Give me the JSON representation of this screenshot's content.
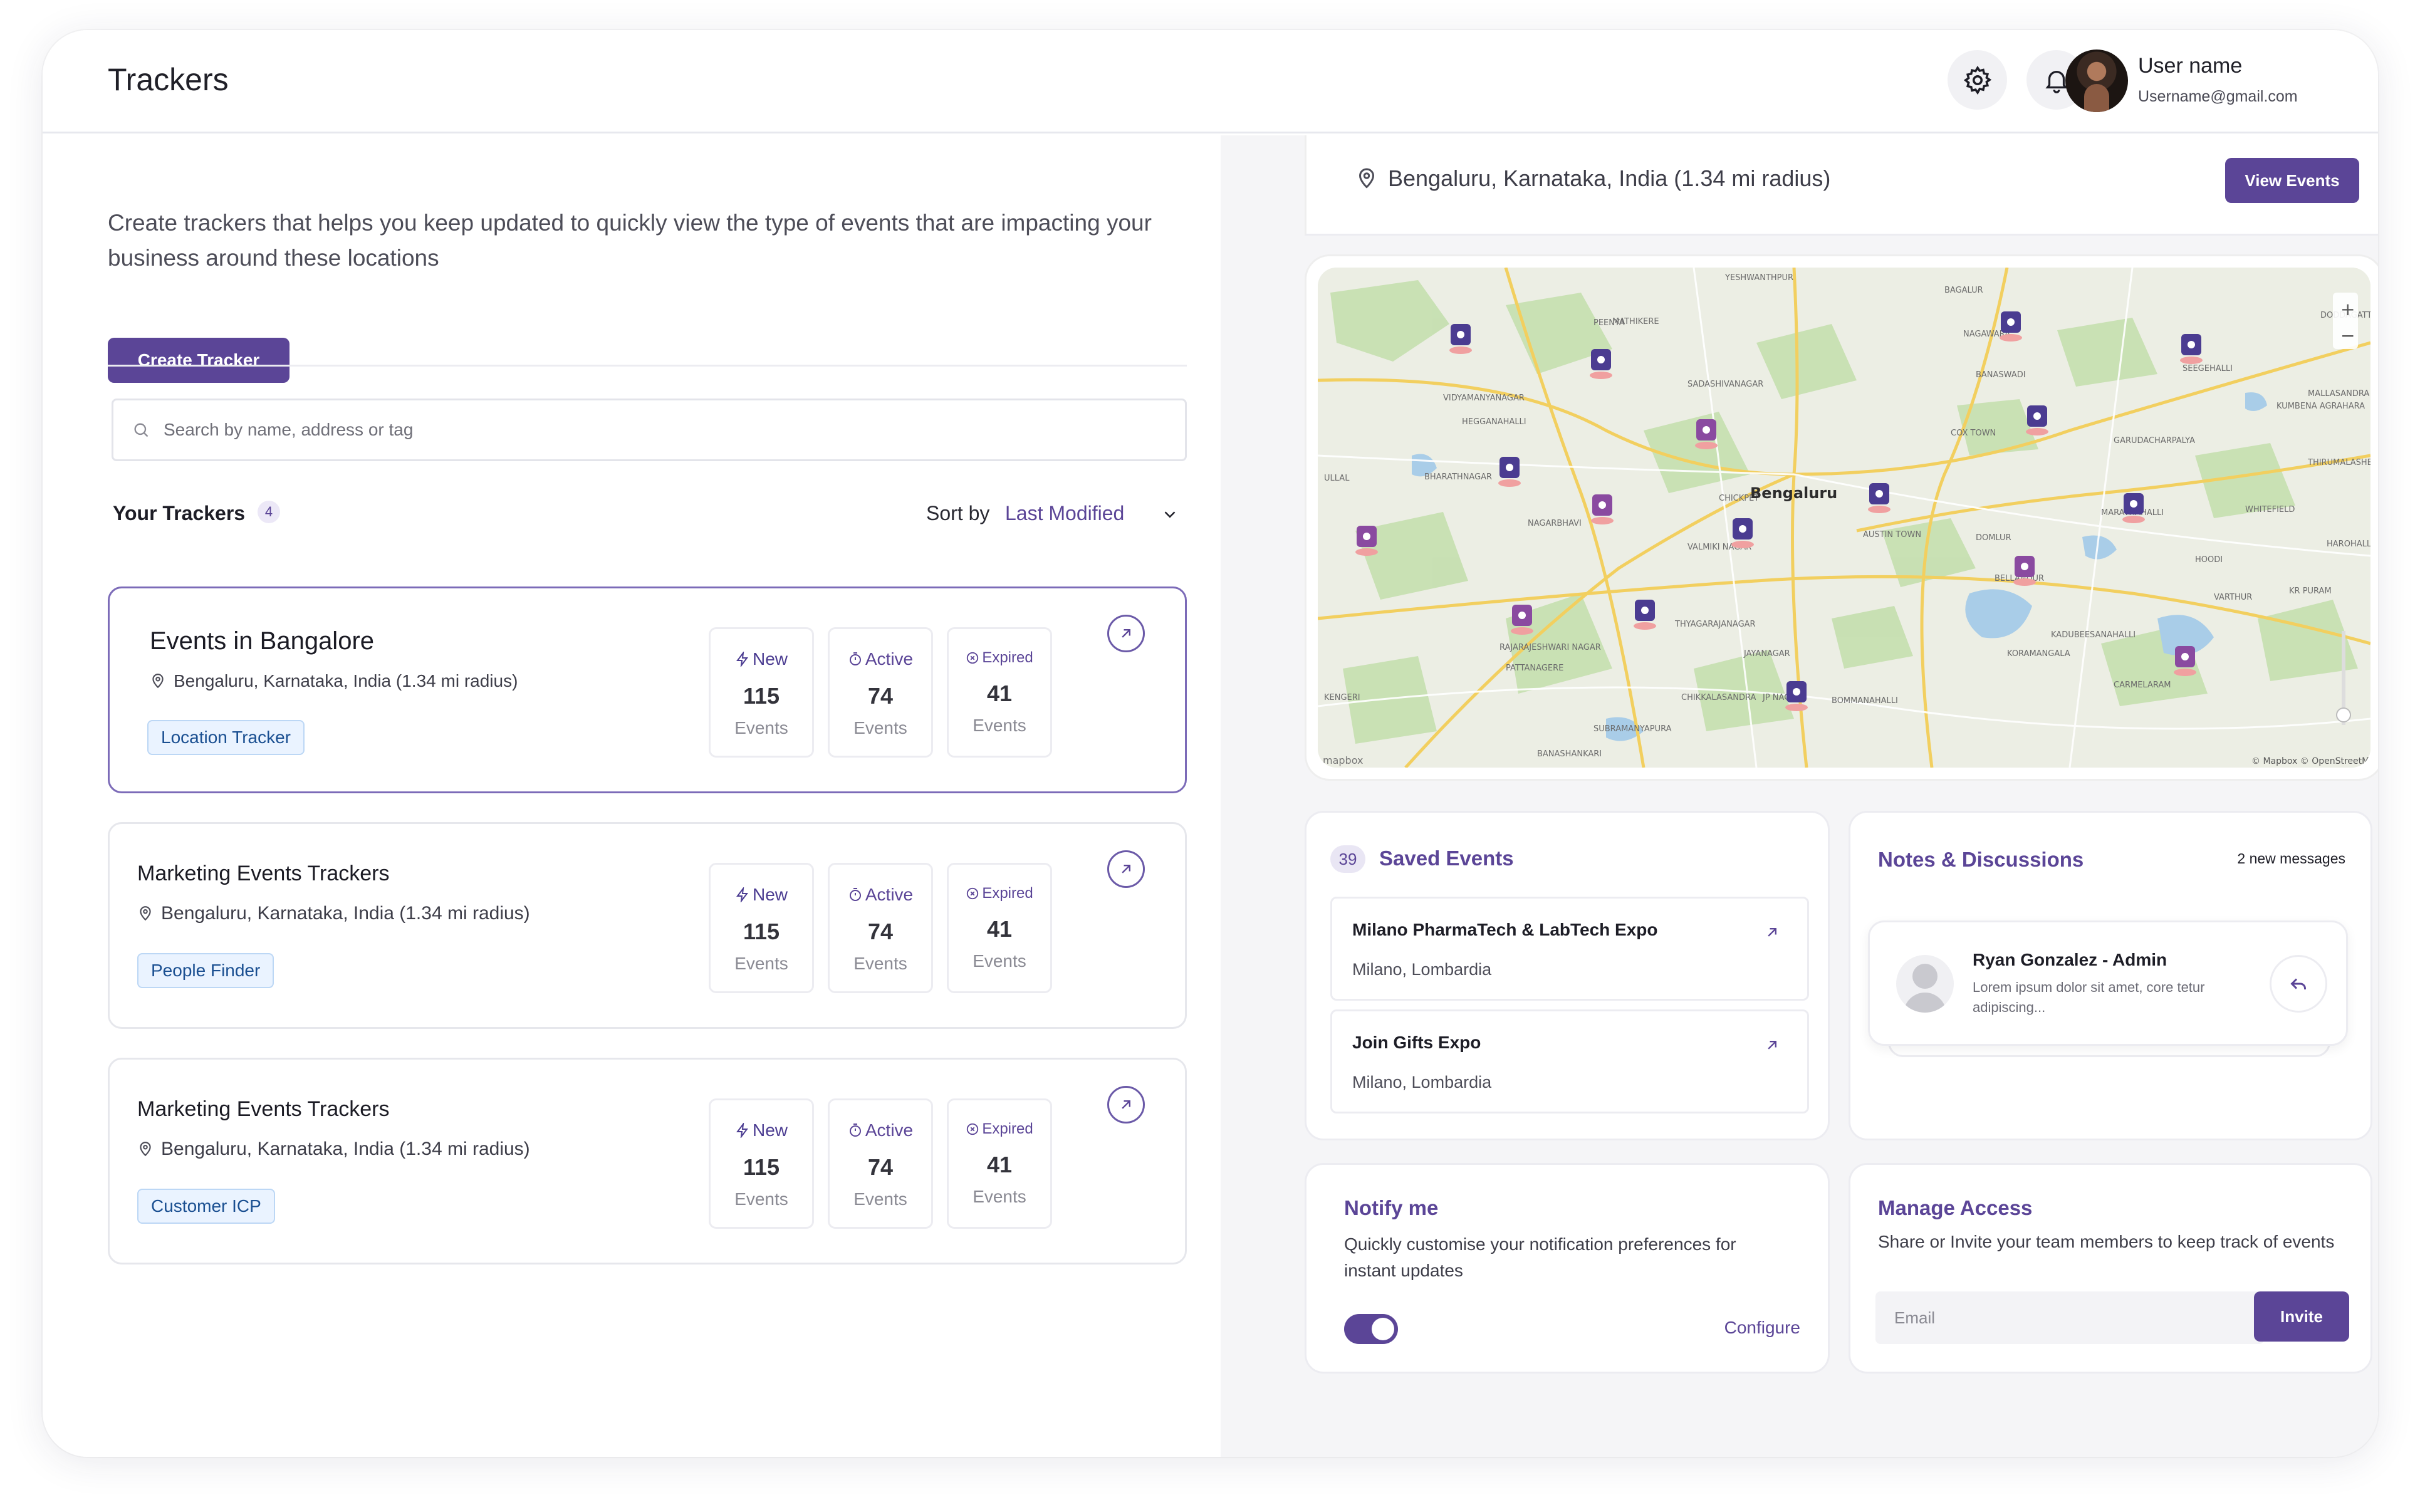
{
  "header": {
    "title": "Trackers",
    "user_name": "User name",
    "user_email": "Username@gmail.com",
    "icons": [
      "gear-icon",
      "bell-icon"
    ]
  },
  "intro": "Create trackers that helps you keep updated to quickly view the type of events that are impacting your business around these locations",
  "create_button": "Create Tracker",
  "search": {
    "placeholder": "Search by name, address or tag"
  },
  "your_trackers": {
    "label": "Your Trackers",
    "count": "4"
  },
  "sort": {
    "label": "Sort by",
    "value": "Last Modified"
  },
  "trackers": [
    {
      "title": "Events in Bangalore",
      "location": "Bengaluru, Karnataka, India (1.34 mi radius)",
      "tag": "Location Tracker",
      "new_label": "New",
      "new_count": "115",
      "active_label": "Active",
      "active_count": "74",
      "expired_label": "Expired",
      "expired_count": "41",
      "events_label": "Events"
    },
    {
      "title": "Marketing Events Trackers",
      "location": "Bengaluru, Karnataka, India (1.34 mi radius)",
      "tag": "People Finder",
      "new_label": "New",
      "new_count": "115",
      "active_label": "Active",
      "active_count": "74",
      "expired_label": "Expired",
      "expired_count": "41",
      "events_label": "Events"
    },
    {
      "title": "Marketing Events Trackers",
      "location": "Bengaluru, Karnataka, India (1.34 mi radius)",
      "tag": "Customer ICP",
      "new_label": "New",
      "new_count": "115",
      "active_label": "Active",
      "active_count": "74",
      "expired_label": "Expired",
      "expired_count": "41",
      "events_label": "Events"
    }
  ],
  "location_bar": {
    "text": "Bengaluru, Karnataka, India (1.34 mi radius)",
    "button": "View Events"
  },
  "map": {
    "city_label": "Bengaluru",
    "area_labels": [
      "YESHWANTHPUR",
      "VIDYAMANYANAGAR",
      "HEGGANAHALLI",
      "BHARATHNAGAR",
      "NAGARBHAVI",
      "RAJARAJESHWARI NAGAR",
      "PATTANAGERE",
      "CHIKKALASANDRA",
      "COX TOWN",
      "DOMLUR",
      "WHITEFIELD",
      "VARTHUR",
      "CARMELARAM",
      "KORAMANGALA",
      "BANASWADI",
      "GARUDACHARPALYA",
      "SEEGEHALLI",
      "MARATHAHALLI",
      "BOMMANAHALLI",
      "THYAGARAJANAGAR",
      "JAYANAGAR",
      "BANASHANKARI",
      "SUBRAMANYAPURA",
      "MATHIKERE",
      "SADASHIVANAGAR",
      "PEENYA",
      "NAGAWARA",
      "CHICKPET",
      "AUSTIN TOWN",
      "JP NAGAR",
      "KADUBEESANAHALLI",
      "BELLANDUR",
      "KUMBENA AGRAHARA",
      "MALLASANDRA",
      "THIRUMALASHETTIHALLI",
      "HAROHALLI",
      "KENGERI",
      "ULLAL",
      "VALMIKI NAGAR",
      "BAGALUR",
      "DODDAGATTI",
      "HOODI",
      "KR PURAM"
    ],
    "attribution": "© Mapbox © OpenStreetMap",
    "logo": "mapbox",
    "zoom_in": "+",
    "zoom_out": "−"
  },
  "saved_events": {
    "count": "39",
    "title": "Saved Events",
    "items": [
      {
        "name": "Milano PharmaTech & LabTech Expo",
        "place": "Milano, Lombardia"
      },
      {
        "name": "Join Gifts Expo",
        "place": "Milano, Lombardia"
      }
    ]
  },
  "notes": {
    "title": "Notes & Discussions",
    "new_messages": "2 new messages",
    "message": {
      "author": "Ryan Gonzalez - Admin",
      "preview": "Lorem ipsum dolor sit amet, core tetur adipiscing..."
    }
  },
  "notify": {
    "title": "Notify me",
    "text": "Quickly customise your notification preferences for instant updates",
    "toggle_on": true,
    "configure": "Configure"
  },
  "manage_access": {
    "title": "Manage Access",
    "text": "Share or Invite your team members to keep track of events",
    "placeholder": "Email",
    "invite": "Invite"
  },
  "colors": {
    "accent": "#5b4597",
    "tag_bg": "#eaf3ff",
    "tag_text": "#1a4f91"
  }
}
